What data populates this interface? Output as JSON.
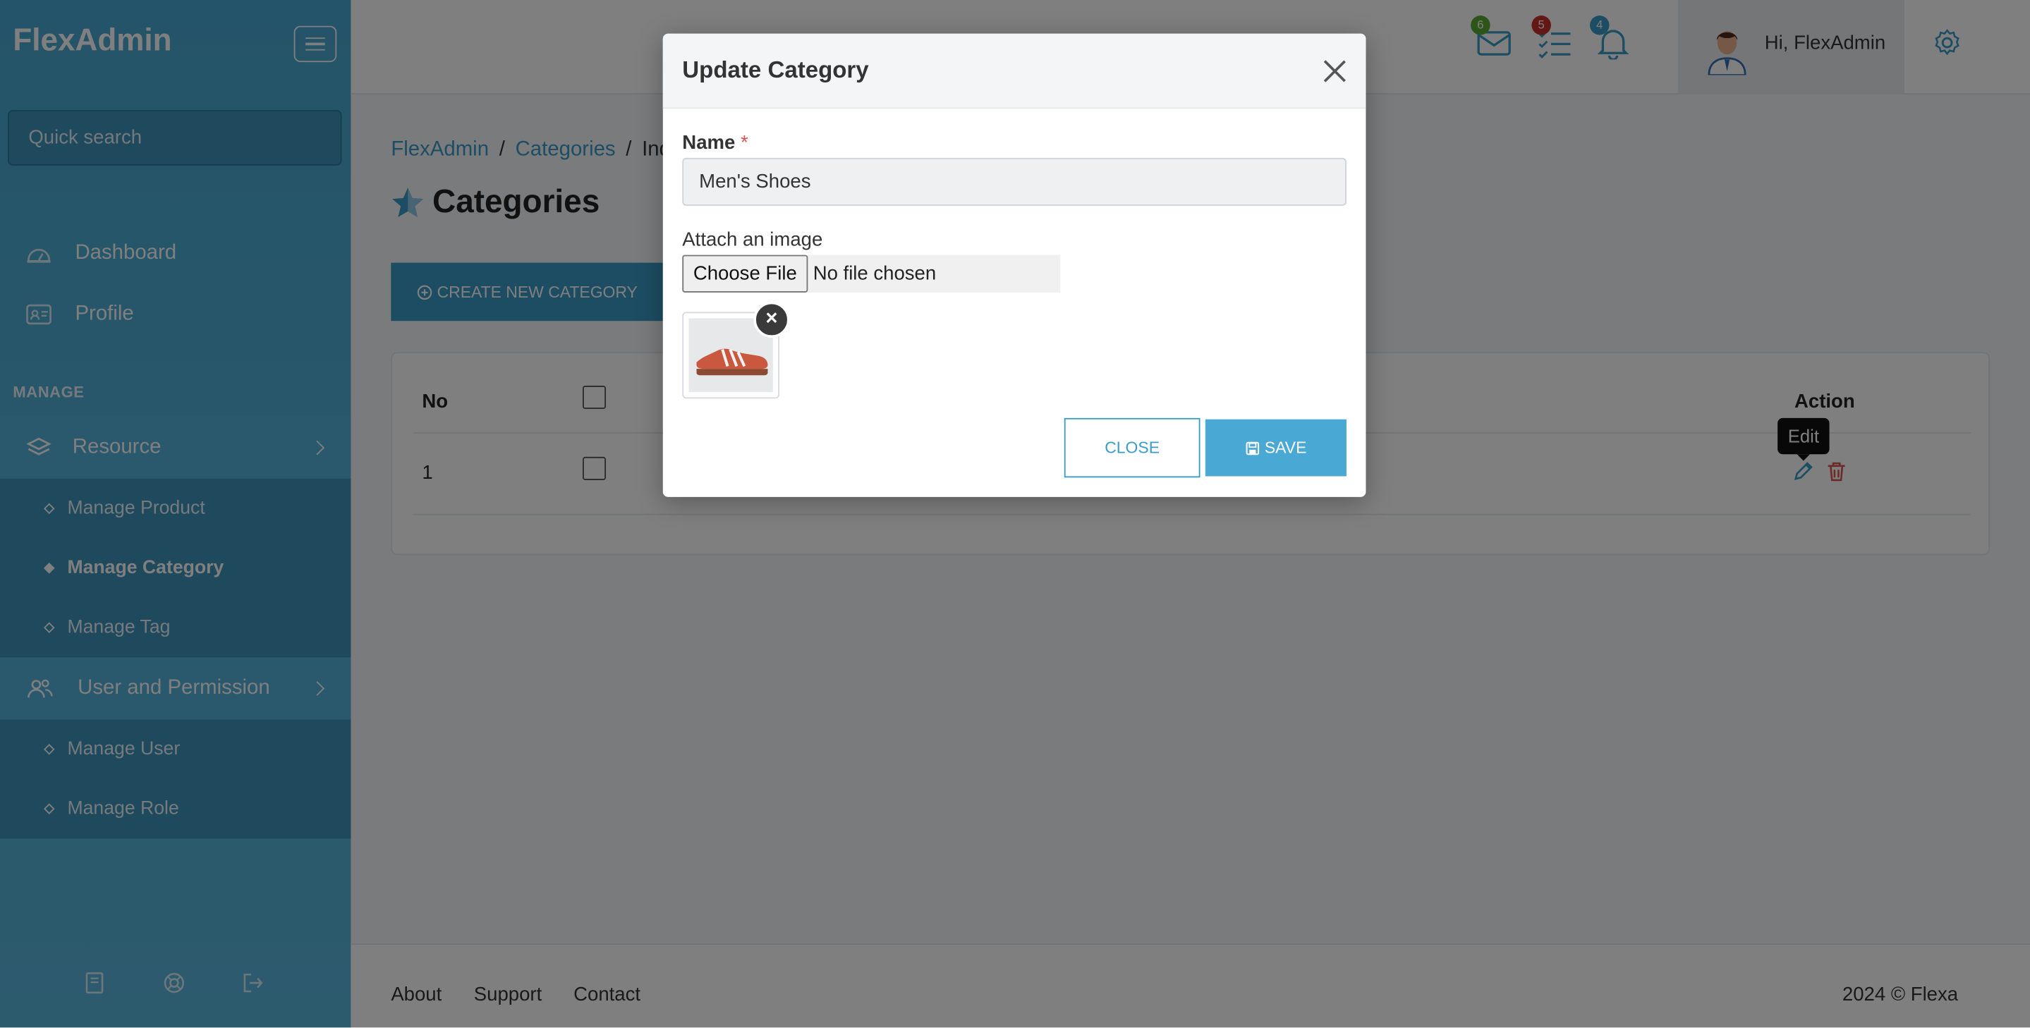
{
  "app": {
    "brand": "FlexAdmin"
  },
  "sidebar": {
    "search_placeholder": "Quick search",
    "nav": [
      {
        "label": "Dashboard",
        "icon": "dashboard-icon"
      },
      {
        "label": "Profile",
        "icon": "profile-card-icon"
      }
    ],
    "section_label": "MANAGE",
    "groups": [
      {
        "label": "Resource",
        "icon": "layers-icon",
        "items": [
          {
            "label": "Manage Product",
            "active": false
          },
          {
            "label": "Manage Category",
            "active": true
          },
          {
            "label": "Manage Tag",
            "active": false
          }
        ]
      },
      {
        "label": "User and Permission",
        "icon": "users-icon",
        "items": [
          {
            "label": "Manage User",
            "active": false
          },
          {
            "label": "Manage Role",
            "active": false
          }
        ]
      }
    ],
    "footer_icons": [
      "book-icon",
      "lifebuoy-icon",
      "logout-icon"
    ]
  },
  "topbar": {
    "mail_count": "6",
    "tasks_count": "5",
    "notifications_count": "4",
    "greeting": "Hi, FlexAdmin",
    "badge_colors": {
      "mail": "#5aa832",
      "tasks": "#c9302c",
      "notifications": "#3b9bc7"
    }
  },
  "breadcrumb": {
    "items": [
      "FlexAdmin",
      "Categories"
    ],
    "current": "Ind"
  },
  "page": {
    "title": "Categories",
    "create_button": "CREATE NEW CATEGORY"
  },
  "table": {
    "headers": {
      "no": "No",
      "action": "Action"
    },
    "rows": [
      {
        "no": "1"
      }
    ],
    "tooltip": "Edit"
  },
  "footer": {
    "links": [
      "About",
      "Support",
      "Contact"
    ],
    "copyright": "2024 © Flexa"
  },
  "modal": {
    "title": "Update Category",
    "name_label": "Name",
    "required_mark": "*",
    "name_value": "Men's Shoes",
    "image_label": "Attach an image",
    "file_button": "Choose File",
    "file_status": "No file chosen",
    "close_button": "CLOSE",
    "save_button": "SAVE"
  },
  "colors": {
    "primary": "#3b9bc7",
    "sidebar": "#4fb0d8",
    "danger": "#d9534f"
  }
}
